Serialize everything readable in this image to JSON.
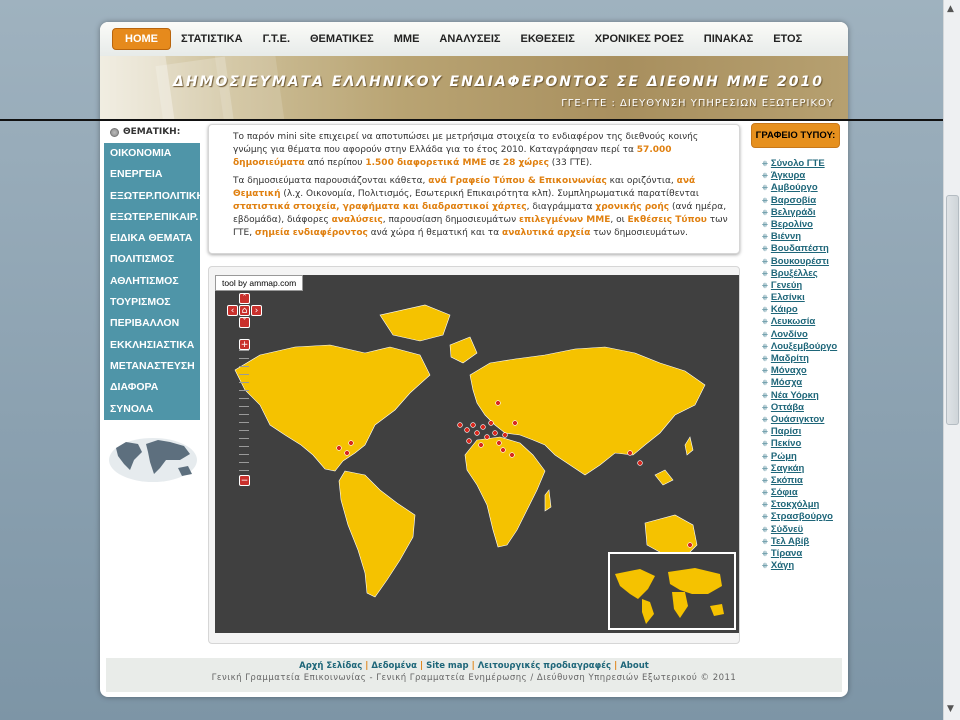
{
  "nav": {
    "items": [
      "HOME",
      "ΣΤΑΤΙΣΤΙΚΑ",
      "Γ.Τ.Ε.",
      "ΘΕΜΑΤΙΚΕΣ",
      "ΜΜΕ",
      "ΑΝΑΛΥΣΕΙΣ",
      "ΕΚΘΕΣΕΙΣ",
      "ΧΡΟΝΙΚΕΣ ΡΟΕΣ",
      "ΠΙΝΑΚΑΣ",
      "ΕΤΟΣ"
    ]
  },
  "banner": {
    "title": "ΔΗΜΟΣΙΕΥΜΑΤΑ ΕΛΛΗΝΙΚΟΥ ΕΝΔΙΑΦΕΡΟΝΤΟΣ ΣΕ ΔΙΕΘΝΗ ΜΜΕ 2010",
    "subtitle": "ΓΓΕ-ΓΤΕ : ΔΙΕΥΘΥΝΣΗ ΥΠΗΡΕΣΙΩΝ ΕΞΩΤΕΡΙΚΟΥ"
  },
  "thematic": {
    "heading": "ΘΕΜΑΤΙΚΗ:",
    "items": [
      "ΟΙΚΟΝΟΜΙΑ",
      "ΕΝΕΡΓΕΙΑ",
      "ΕΞΩΤΕΡ.ΠΟΛΙΤΙΚΗ",
      "ΕΞΩΤΕΡ.ΕΠΙΚΑΙΡ.",
      "ΕΙΔΙΚΑ ΘΕΜΑΤΑ",
      "ΠΟΛΙΤΙΣΜΟΣ",
      "ΑΘΛΗΤΙΣΜΟΣ",
      "ΤΟΥΡΙΣΜΟΣ",
      "ΠΕΡΙΒΑΛΛΟΝ",
      "ΕΚΚΛΗΣΙΑΣΤΙΚΑ",
      "ΜΕΤΑΝΑΣΤΕΥΣΗ",
      "ΔΙΑΦΟΡΑ",
      "ΣΥΝΟΛΑ"
    ]
  },
  "intro": {
    "p1_a": "Το παρόν mini site επιχειρεί να αποτυπώσει με μετρήσιμα στοιχεία το ενδιαφέρον της διεθνούς κοινής γνώμης για θέματα που αφορούν στην Ελλάδα για το έτος 2010. Καταγράφησαν περί τα ",
    "p1_b": "57.000 δημοσιεύματα",
    "p1_c": " από περίπου ",
    "p1_d": "1.500 διαφορετικά ΜΜΕ",
    "p1_e": " σε ",
    "p1_f": "28 χώρες",
    "p1_g": " (33 ΓΤΕ).",
    "p2_a": "Τα δημοσιεύματα παρουσιάζονται κάθετα, ",
    "p2_b": "ανά Γραφείο Τύπου & Επικοινωνίας",
    "p2_c": " και οριζόντια, ",
    "p2_d": "ανά Θεματική",
    "p2_e": " (λ.χ. Οικονομία, Πολιτισμός, Εσωτερική Επικαιρότητα κλπ). Συμπληρωματικά παρατίθενται ",
    "p2_f": "στατιστικά στοιχεία, γραφήματα και διαδραστικοί χάρτες",
    "p2_g": ", διαγράμματα ",
    "p2_h": "χρονικής ροής",
    "p2_i": " (ανά ημέρα, εβδομάδα), διάφορες ",
    "p2_j": "αναλύσεις",
    "p2_k": ", παρουσίαση δημοσιευμάτων ",
    "p2_l": "επιλεγμένων ΜΜΕ",
    "p2_m": ", οι ",
    "p2_n": "Εκθέσεις Τύπου",
    "p2_o": " των ΓΤΕ, ",
    "p2_p": "σημεία ενδιαφέροντος",
    "p2_q": " ανά χώρα ή θεματική  και τα ",
    "p2_r": "αναλυτικά αρχεία",
    "p2_s": " των δημοσιευμάτων."
  },
  "map": {
    "tag": "tool by ammap.com",
    "land_color": "#f5c200",
    "sea_color": "#404040",
    "marker_color": "#d8281e"
  },
  "press": {
    "heading": "ΓΡΑΦΕΙΟ ΤΥΠΟΥ:",
    "cities": [
      "Σύνολο ΓΤΕ",
      "Άγκυρα",
      "Αμβούργο",
      "Βαρσοβία",
      "Βελιγράδι",
      "Βερολίνο",
      "Βιέννη",
      "Βουδαπέστη",
      "Βουκουρέστι",
      "Βρυξέλλες",
      "Γενεύη",
      "Ελσίνκι",
      "Κάιρο",
      "Λευκωσία",
      "Λονδίνο",
      "Λουξεμβούργο",
      "Μαδρίτη",
      "Μόναχο",
      "Μόσχα",
      "Νέα Υόρκη",
      "Οττάβα",
      "Ουάσιγκτον",
      "Παρίσι",
      "Πεκίνο",
      "Ρώμη",
      "Σαγκάη",
      "Σκόπια",
      "Σόφια",
      "Στοκχόλμη",
      "Στρασβούργο",
      "Σύδνεϋ",
      "Τελ Αβίβ",
      "Τίρανα",
      "Χάγη"
    ]
  },
  "footer": {
    "links": [
      "Αρχή Σελίδας",
      "Δεδομένα",
      "Site map",
      "Λειτουργικές προδιαγραφές",
      "About"
    ],
    "copy": "Γενική Γραμματεία Επικοινωνίας - Γενική Γραμματεία Ενημέρωσης / Διεύθυνση Υπηρεσιών Εξωτερικού  © 2011"
  }
}
